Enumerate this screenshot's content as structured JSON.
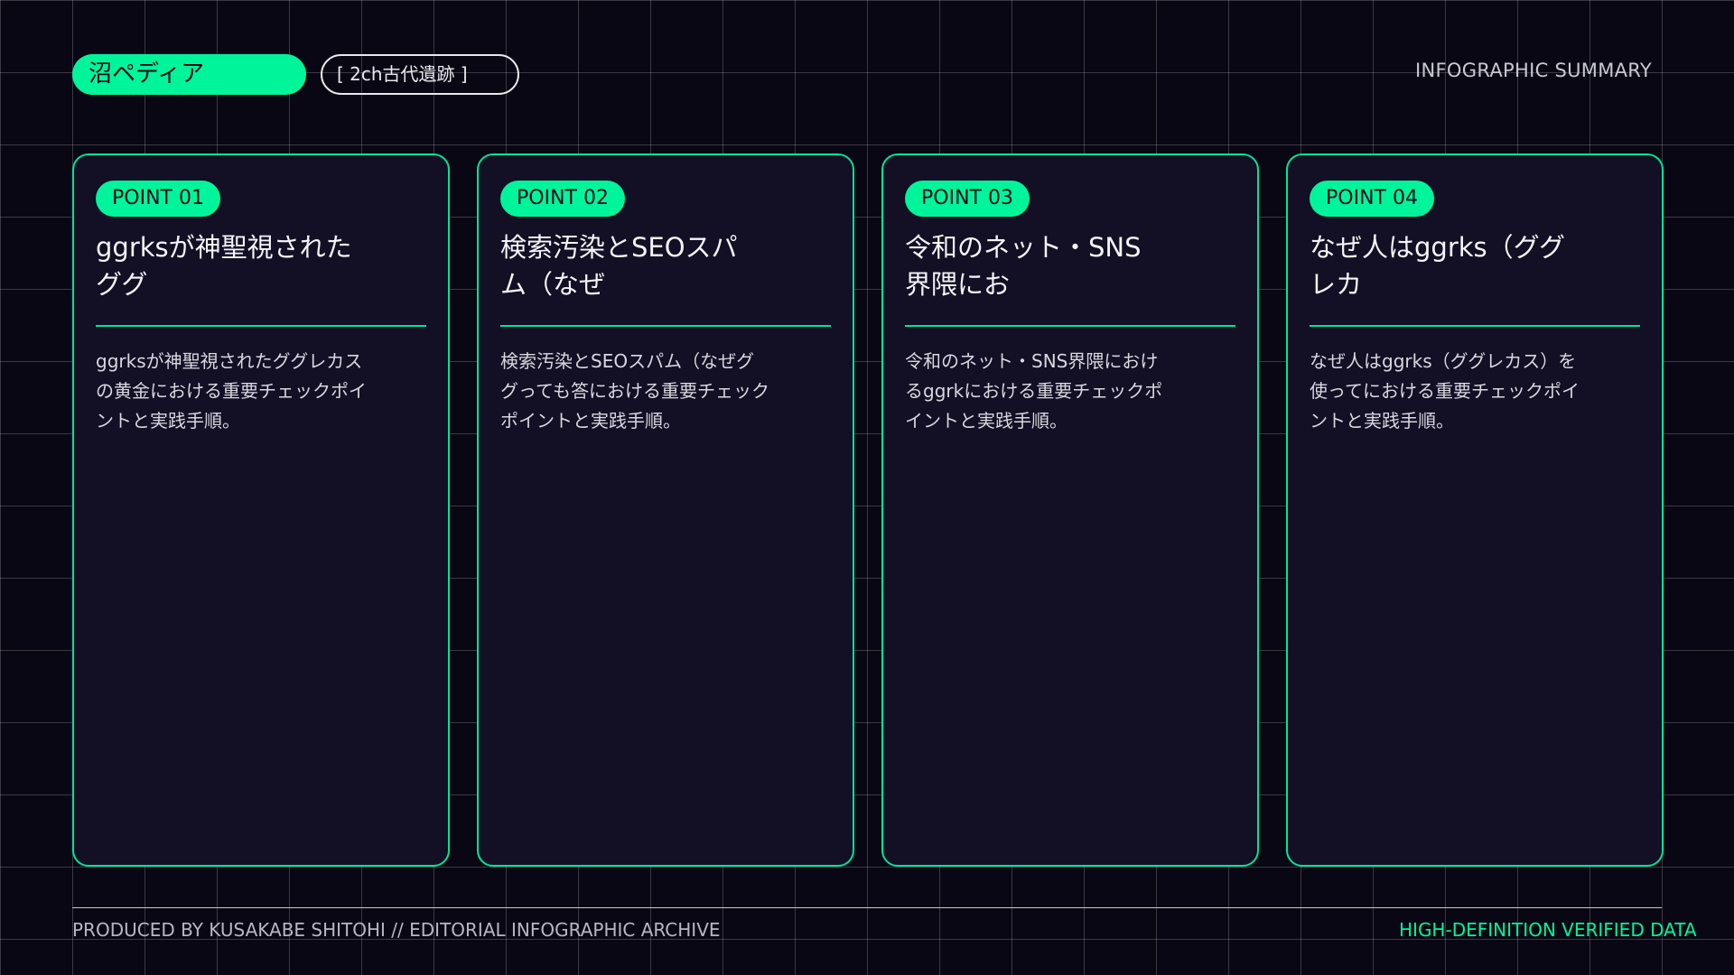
{
  "header": {
    "brand": "沼ペディア",
    "tag": "[ 2ch古代遺跡 ]",
    "label": "INFOGRAPHIC SUMMARY"
  },
  "cards": [
    {
      "badge": "POINT 01",
      "title": "ggrksが神聖視されたググ",
      "body": "ggrksが神聖視されたググレカスの黄金における重要チェックポイントと実践手順。"
    },
    {
      "badge": "POINT 02",
      "title": "検索汚染とSEOスパム（なぜ",
      "body": "検索汚染とSEOスパム（なぜググっても答における重要チェックポイントと実践手順。"
    },
    {
      "badge": "POINT 03",
      "title": "令和のネット・SNS界隈にお",
      "body": "令和のネット・SNS界隈におけるggrkにおける重要チェックポイントと実践手順。"
    },
    {
      "badge": "POINT 04",
      "title": "なぜ人はggrks（ググレカ",
      "body": "なぜ人はggrks（ググレカス）を使ってにおける重要チェックポイントと実践手順。"
    }
  ],
  "footer": {
    "left": "PRODUCED BY KUSAKABE SHITOHI // EDITORIAL INFOGRAPHIC ARCHIVE",
    "right": "HIGH-DEFINITION VERIFIED DATA"
  },
  "colors": {
    "background": "#090713",
    "card": "#130f24",
    "accent": "#00f59b"
  }
}
